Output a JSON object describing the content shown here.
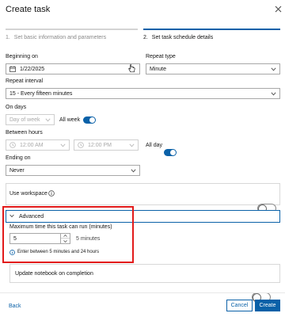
{
  "dialog": {
    "title": "Create task"
  },
  "steps": [
    {
      "number": "1.",
      "label": "Set basic information and parameters"
    },
    {
      "number": "2.",
      "label": "Set task schedule details"
    }
  ],
  "beginning": {
    "label": "Beginning on",
    "value": "1/22/2025"
  },
  "repeat_type": {
    "label": "Repeat type",
    "value": "Minute"
  },
  "repeat_interval": {
    "label": "Repeat interval",
    "value": "15 - Every fifteen minutes"
  },
  "on_days": {
    "label": "On days",
    "placeholder": "Day of week",
    "all_week_label": "All week",
    "all_week_on": true
  },
  "between_hours": {
    "label": "Between hours",
    "start": "12:00 AM",
    "end": "12:00 PM",
    "all_day_label": "All day",
    "all_day_on": true
  },
  "ending": {
    "label": "Ending on",
    "value": "Never"
  },
  "workspace": {
    "label": "Use workspace",
    "on": false
  },
  "advanced": {
    "header": "Advanced",
    "max_time_label": "Maximum time this task can run (minutes)",
    "max_time_value": "5",
    "max_time_display": "5 minutes",
    "info": "Enter between 5 minutes and 24 hours"
  },
  "update_notebook": {
    "label": "Update notebook on completion",
    "on": false
  },
  "footer": {
    "back": "Back",
    "cancel": "Cancel",
    "create": "Create"
  },
  "colors": {
    "accent": "#0a61a8",
    "highlight": "#e21b1b",
    "muted": "#a8a8a8"
  },
  "icons": [
    "close-icon",
    "calendar-icon",
    "chevron-down-icon",
    "clock-icon",
    "info-icon",
    "chevron-down-icon",
    "stepper-up-icon",
    "stepper-down-icon"
  ]
}
